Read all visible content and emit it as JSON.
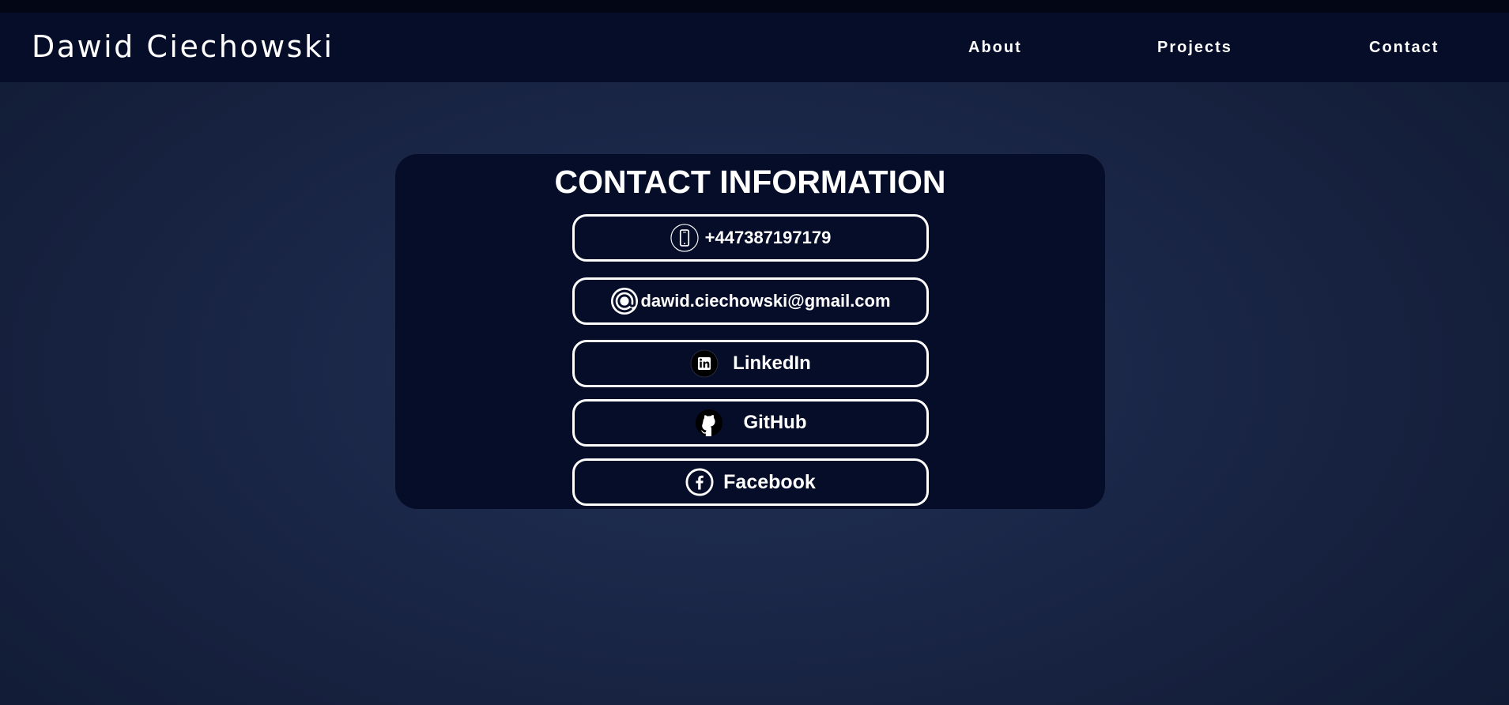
{
  "header": {
    "brand": "Dawid Ciechowski",
    "nav": [
      {
        "label": "About"
      },
      {
        "label": "Projects"
      },
      {
        "label": "Contact"
      }
    ]
  },
  "contact": {
    "title": "CONTACT INFORMATION",
    "items": [
      {
        "icon": "phone-icon",
        "label": "+447387197179"
      },
      {
        "icon": "at-sign-icon",
        "label": "dawid.ciechowski@gmail.com"
      },
      {
        "icon": "linkedin-icon",
        "label": "LinkedIn"
      },
      {
        "icon": "github-icon",
        "label": "GitHub"
      },
      {
        "icon": "facebook-icon",
        "label": "Facebook"
      }
    ]
  },
  "colors": {
    "navbar_background": "#050d29",
    "card_background": "#050d29",
    "page_background_center": "#213054",
    "page_background_edge": "#101a33",
    "text": "#ffffff"
  }
}
